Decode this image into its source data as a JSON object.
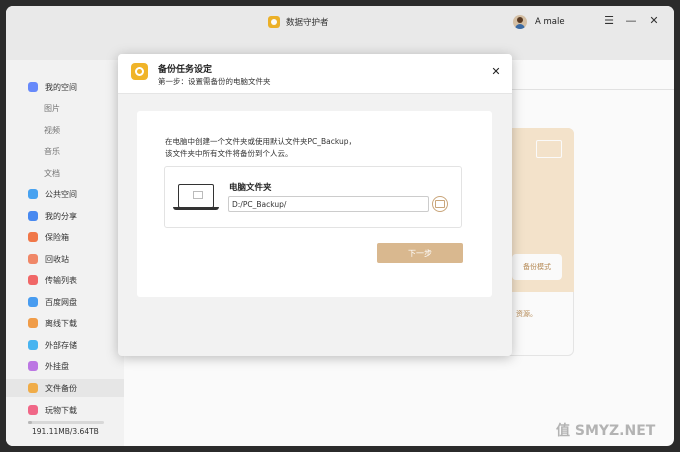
{
  "app": {
    "title": "数据守护者",
    "user": "A male"
  },
  "window_controls": {
    "menu": "☰",
    "minimize": "—",
    "close": "✕"
  },
  "sidebar": {
    "items": [
      {
        "label": "我的空间",
        "icon": "my-space-icon",
        "color": "#6a8cff"
      },
      {
        "label": "图片",
        "sub": true
      },
      {
        "label": "视频",
        "sub": true
      },
      {
        "label": "音乐",
        "sub": true
      },
      {
        "label": "文档",
        "sub": true
      },
      {
        "label": "公共空间",
        "icon": "public-space-icon",
        "color": "#4aa6f5"
      },
      {
        "label": "我的分享",
        "icon": "share-icon",
        "color": "#4a8cf5"
      },
      {
        "label": "保险箱",
        "icon": "safe-icon",
        "color": "#f57a4a"
      },
      {
        "label": "回收站",
        "icon": "recycle-icon",
        "color": "#f58a6a"
      },
      {
        "label": "传输列表",
        "icon": "transfer-icon",
        "color": "#f56a6a"
      },
      {
        "label": "百度网盘",
        "icon": "baidu-icon",
        "color": "#4aa0f5"
      },
      {
        "label": "离线下载",
        "icon": "offline-download-icon",
        "color": "#f5a04a"
      },
      {
        "label": "外部存储",
        "icon": "external-storage-icon",
        "color": "#4ab8f5"
      },
      {
        "label": "外挂盘",
        "icon": "mount-disk-icon",
        "color": "#c07ae8"
      },
      {
        "label": "文件备份",
        "icon": "file-backup-icon",
        "color": "#f5b04a",
        "active": true
      },
      {
        "label": "玩物下载",
        "icon": "wanwu-download-icon",
        "color": "#f56a8a"
      }
    ],
    "storage": {
      "text": "191.11MB/3.64TB",
      "fraction": 0.05
    }
  },
  "background": {
    "mode_button": "备份模式",
    "note": "资源。"
  },
  "modal": {
    "title": "备份任务设定",
    "step": "第一步：设置需备份的电脑文件夹",
    "close": "✕",
    "desc_line1": "在电脑中创建一个文件夹或使用默认文件夹PC_Backup，",
    "desc_line2": "该文件夹中所有文件将备份到个人云。",
    "folder_title": "电脑文件夹",
    "folder_path": "D:/PC_Backup/",
    "next_label": "下一步"
  },
  "watermark": "值 SMYZ.NET"
}
